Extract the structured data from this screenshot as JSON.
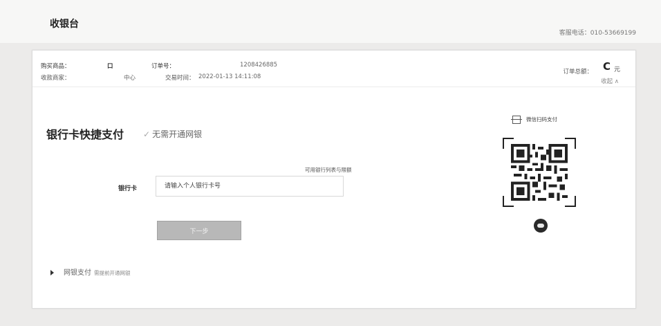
{
  "header": {
    "title": "收银台",
    "hotline": "客服电话：010-53669199"
  },
  "order": {
    "product_label": "购买商品：",
    "product_value": "口",
    "merchant_label": "收款商家：",
    "merchant_value": "中心",
    "order_no_label": "订单号：",
    "order_no_value": "1208426885",
    "time_label": "交易时间：",
    "time_value": "2022-01-13 14:11:08",
    "total_label": "订单总额：",
    "total_amount": "C",
    "total_unit": "元",
    "collapse": "收起 ∧"
  },
  "payment": {
    "title": "银行卡快捷支付",
    "note": "无需开通网银",
    "bank_list_link": "可用银行列表与限额",
    "card_label": "银行卡",
    "card_input_placeholder": "请输入个人银行卡号",
    "next_button": "下一步",
    "netbank_label": "网银支付",
    "netbank_sub": "需提前开通网银"
  },
  "qr": {
    "scan_label": "微信扫码支付"
  }
}
